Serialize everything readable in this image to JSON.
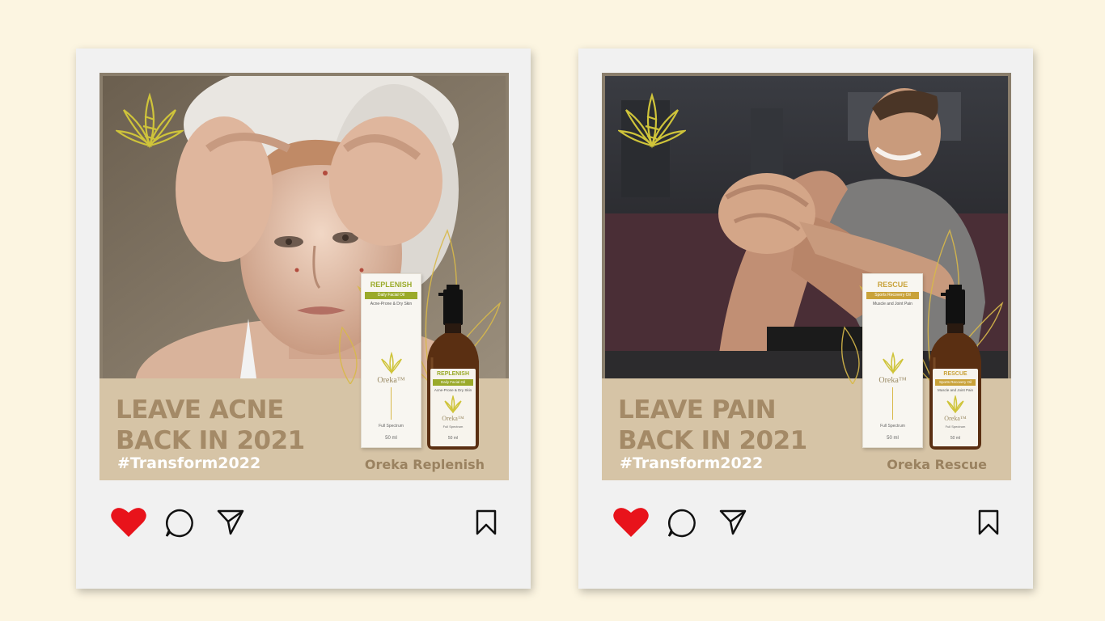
{
  "colors": {
    "background": "#fcf5e1",
    "card": "#f1f1f1",
    "banner": "#d6c4a6",
    "headline": "#a48a67",
    "like": "#e8131b",
    "replenish_accent": "#9aaa2a",
    "rescue_accent": "#c9a23a"
  },
  "posts": [
    {
      "headline": "LEAVE ACNE\nBACK IN 2021",
      "hashtag": "#Transform2022",
      "product_name": "Oreka Replenish",
      "box": {
        "name": "REPLENISH",
        "strip": "Daily Facial Oil",
        "sub": "Acne-Prone & Dry Skin",
        "brand": "Oreka™",
        "full_spectrum": "Full Spectrum",
        "volume": "50 ml"
      },
      "bottle": {
        "name": "REPLENISH",
        "strip": "Daily Facial Oil",
        "sub": "Acne-Prone & Dry Skin",
        "brand": "Oreka™",
        "full_spectrum": "Full Spectrum",
        "volume": "50 ml"
      },
      "icons": [
        "heart-icon",
        "comment-icon",
        "send-icon",
        "bookmark-icon"
      ]
    },
    {
      "headline": "LEAVE PAIN\nBACK IN 2021",
      "hashtag": "#Transform2022",
      "product_name": "Oreka Rescue",
      "box": {
        "name": "RESCUE",
        "strip": "Sports Recovery Oil",
        "sub": "Muscle and Joint Pain",
        "brand": "Oreka™",
        "full_spectrum": "Full Spectrum",
        "volume": "50 ml"
      },
      "bottle": {
        "name": "RESCUE",
        "strip": "Sports Recovery Oil",
        "sub": "Muscle and Joint Pain",
        "brand": "Oreka™",
        "full_spectrum": "Full Spectrum",
        "volume": "50 ml"
      },
      "icons": [
        "heart-icon",
        "comment-icon",
        "send-icon",
        "bookmark-icon"
      ]
    }
  ]
}
